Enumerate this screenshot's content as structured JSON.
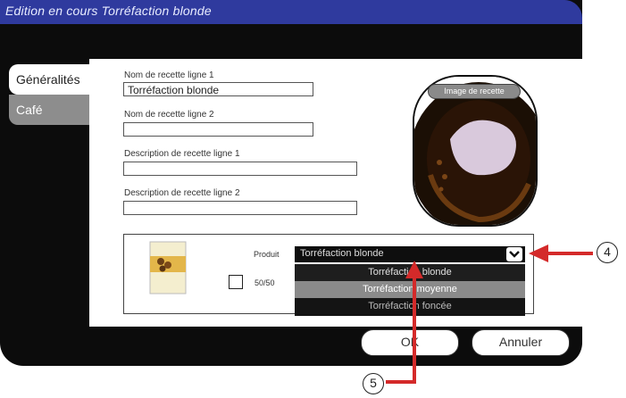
{
  "window": {
    "title": "Edition en cours Torréfaction blonde"
  },
  "tabs": [
    {
      "label": "Généralités",
      "active": true
    },
    {
      "label": "Café",
      "active": false
    }
  ],
  "form": {
    "name_line1": {
      "label": "Nom de recette ligne 1",
      "value": "Torréfaction blonde"
    },
    "name_line2": {
      "label": "Nom de recette ligne 2",
      "value": ""
    },
    "desc_line1": {
      "label": "Description de recette ligne 1",
      "value": ""
    },
    "desc_line2": {
      "label": "Description de recette ligne 2",
      "value": ""
    }
  },
  "image": {
    "button_label": "Image de recette",
    "icon": "coffee-cup-icon"
  },
  "product": {
    "label": "Produit",
    "selected": "Torréfaction blonde",
    "options": [
      "Torréfaction blonde",
      "Torréfaction moyenne",
      "Torréfaction foncée"
    ],
    "highlighted_option": "Torréfaction moyenne",
    "checkbox_label": "50/50",
    "checkbox_checked": false,
    "thumb_icon": "coffee-bag-icon"
  },
  "buttons": {
    "ok": "OK",
    "cancel": "Annuler"
  },
  "callouts": {
    "four": "4",
    "five": "5"
  },
  "colors": {
    "titlebar": "#2f3a9e",
    "arrow": "#d42a2a",
    "dropdown_highlight": "#8a8a8a"
  }
}
